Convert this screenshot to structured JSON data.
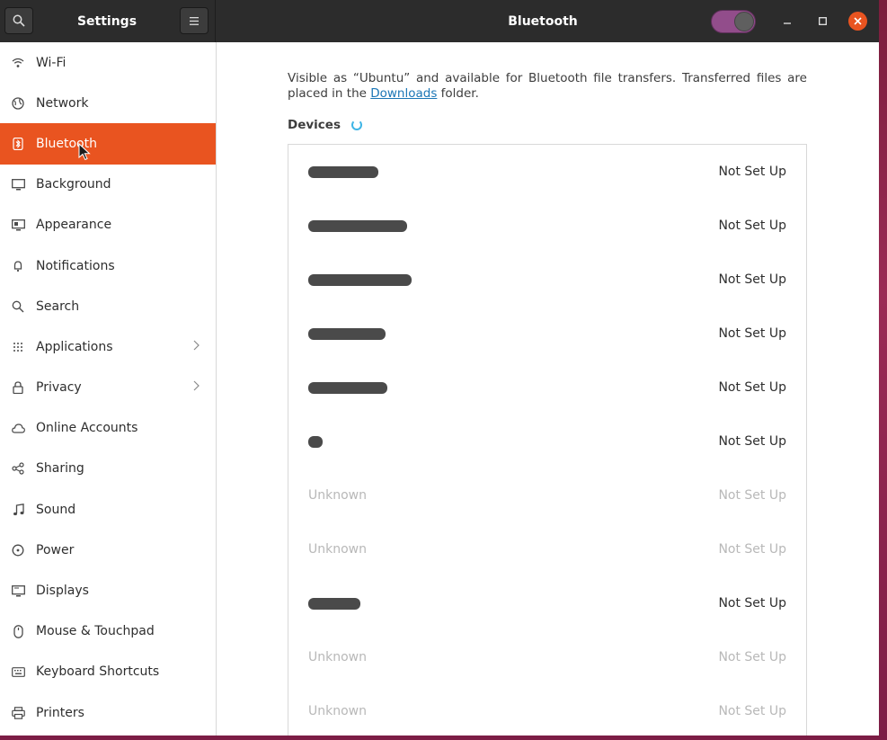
{
  "window": {
    "sidebar_title": "Settings",
    "panel_title": "Bluetooth",
    "bluetooth_enabled": true
  },
  "sidebar": {
    "items": [
      {
        "label": "Wi-Fi",
        "icon": "wifi-icon"
      },
      {
        "label": "Network",
        "icon": "network-icon"
      },
      {
        "label": "Bluetooth",
        "icon": "bluetooth-icon",
        "active": true
      },
      {
        "label": "Background",
        "icon": "background-icon"
      },
      {
        "label": "Appearance",
        "icon": "appearance-icon"
      },
      {
        "label": "Notifications",
        "icon": "bell-icon"
      },
      {
        "label": "Search",
        "icon": "search-icon"
      },
      {
        "label": "Applications",
        "icon": "grid-icon",
        "chevron": true
      },
      {
        "label": "Privacy",
        "icon": "lock-icon",
        "chevron": true
      },
      {
        "label": "Online Accounts",
        "icon": "cloud-icon"
      },
      {
        "label": "Sharing",
        "icon": "share-icon"
      },
      {
        "label": "Sound",
        "icon": "music-note-icon"
      },
      {
        "label": "Power",
        "icon": "power-icon"
      },
      {
        "label": "Displays",
        "icon": "display-icon"
      },
      {
        "label": "Mouse & Touchpad",
        "icon": "mouse-icon"
      },
      {
        "label": "Keyboard Shortcuts",
        "icon": "keyboard-icon"
      },
      {
        "label": "Printers",
        "icon": "printer-icon"
      }
    ]
  },
  "main": {
    "description_before": "Visible as “Ubuntu” and available for Bluetooth file transfers. Transferred files are placed in the ",
    "description_link": "Downloads",
    "description_after": " folder.",
    "devices_heading": "Devices",
    "devices": [
      {
        "name": "",
        "redacted": true,
        "status": "Not Set Up",
        "dim": false
      },
      {
        "name": "",
        "redacted": true,
        "status": "Not Set Up",
        "dim": false
      },
      {
        "name": "",
        "redacted": true,
        "status": "Not Set Up",
        "dim": false
      },
      {
        "name": "",
        "redacted": true,
        "status": "Not Set Up",
        "dim": false
      },
      {
        "name": "",
        "redacted": true,
        "status": "Not Set Up",
        "dim": false
      },
      {
        "name": "",
        "redacted": true,
        "status": "Not Set Up",
        "dim": false
      },
      {
        "name": "Unknown",
        "redacted": false,
        "status": "Not Set Up",
        "dim": true
      },
      {
        "name": "Unknown",
        "redacted": false,
        "status": "Not Set Up",
        "dim": true
      },
      {
        "name": "",
        "redacted": true,
        "status": "Not Set Up",
        "dim": false
      },
      {
        "name": "Unknown",
        "redacted": false,
        "status": "Not Set Up",
        "dim": true
      },
      {
        "name": "Unknown",
        "redacted": false,
        "status": "Not Set Up",
        "dim": true
      }
    ]
  },
  "colors": {
    "accent": "#e95420",
    "header": "#2c2c2c",
    "toggle_on": "#924d8b",
    "link": "#1b76b6"
  }
}
